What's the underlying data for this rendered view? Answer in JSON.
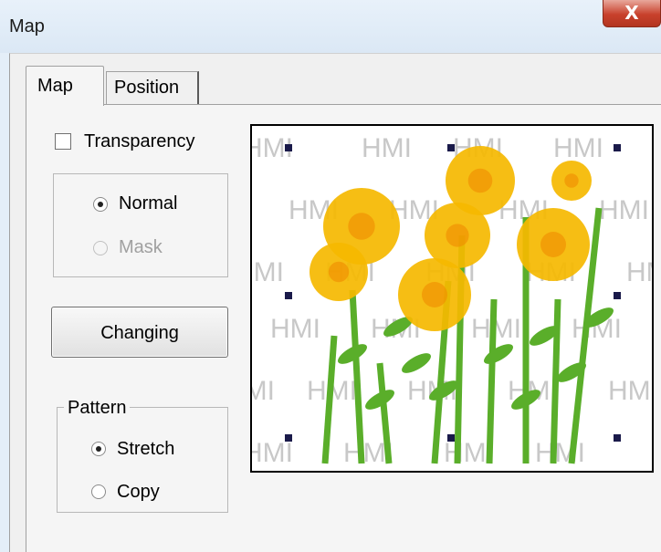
{
  "window": {
    "title": "Map",
    "close_label": "X"
  },
  "tabs": [
    {
      "label": "Map",
      "active": true
    },
    {
      "label": "Position",
      "active": false
    }
  ],
  "transparency": {
    "label": "Transparency",
    "checked": false
  },
  "mode_group": {
    "options": [
      {
        "label": "Normal",
        "selected": true,
        "enabled": true
      },
      {
        "label": "Mask",
        "selected": false,
        "enabled": false
      }
    ]
  },
  "changing_button": {
    "label": "Changing"
  },
  "pattern_group": {
    "title": "Pattern",
    "options": [
      {
        "label": "Stretch",
        "selected": true
      },
      {
        "label": "Copy",
        "selected": false
      }
    ]
  },
  "preview": {
    "watermark_text": "HMI",
    "watermark_color": "#c8c8c8",
    "flower_color": "#f5b800",
    "stem_color": "#5aae2a",
    "handle_color": "#1a1a4a"
  }
}
